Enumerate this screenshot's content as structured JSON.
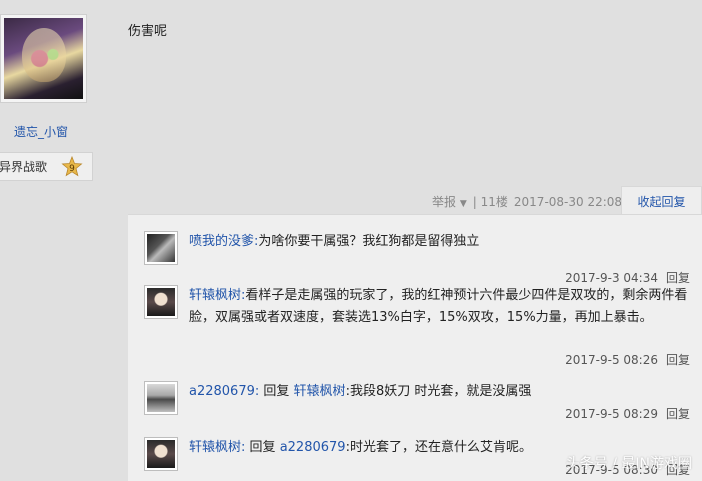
{
  "user": {
    "name": "遗忘_小窗",
    "badge_label": "异界战歌",
    "badge_level": "9",
    "avatar_icon": "anime-girl-avatar"
  },
  "post": {
    "text": "伤害呢",
    "report_label": "举报",
    "floor": "| 11楼",
    "timestamp": "2017-08-30 22:08",
    "collapse_replies": "收起回复"
  },
  "comments": [
    {
      "user": "喷我的没爹:",
      "text": "为啥你要干属强？我红狗都是留得独立",
      "time": "2017-9-3 04:34",
      "reply": "回复"
    },
    {
      "user": "轩辕枫树:",
      "text": "看样子是走属强的玩家了，我的红神预计六件最少四件是双攻的，剩余两件看脸，双属强或者双速度，套装选13%白字，15%双攻，15%力量，再加上暴击。",
      "time": "2017-9-5 08:26",
      "reply": "回复"
    },
    {
      "user": "a2280679:",
      "reply_word": "回复",
      "target": "轩辕枫树",
      "text": ":我段8妖刀 时光套，就是没属强",
      "time": "2017-9-5 08:29",
      "reply": "回复"
    },
    {
      "user": "轩辕枫树:",
      "reply_word": "回复",
      "target": "a2280679",
      "text": ":时光套了，还在意什么艾肯呢。",
      "time": "2017-9-5 08:30",
      "reply": "回复"
    }
  ],
  "watermark": "头条号 / 最IN游戏圈",
  "colors": {
    "link": "#2255aa",
    "background": "#e0e0e0",
    "panel": "#efefef"
  }
}
